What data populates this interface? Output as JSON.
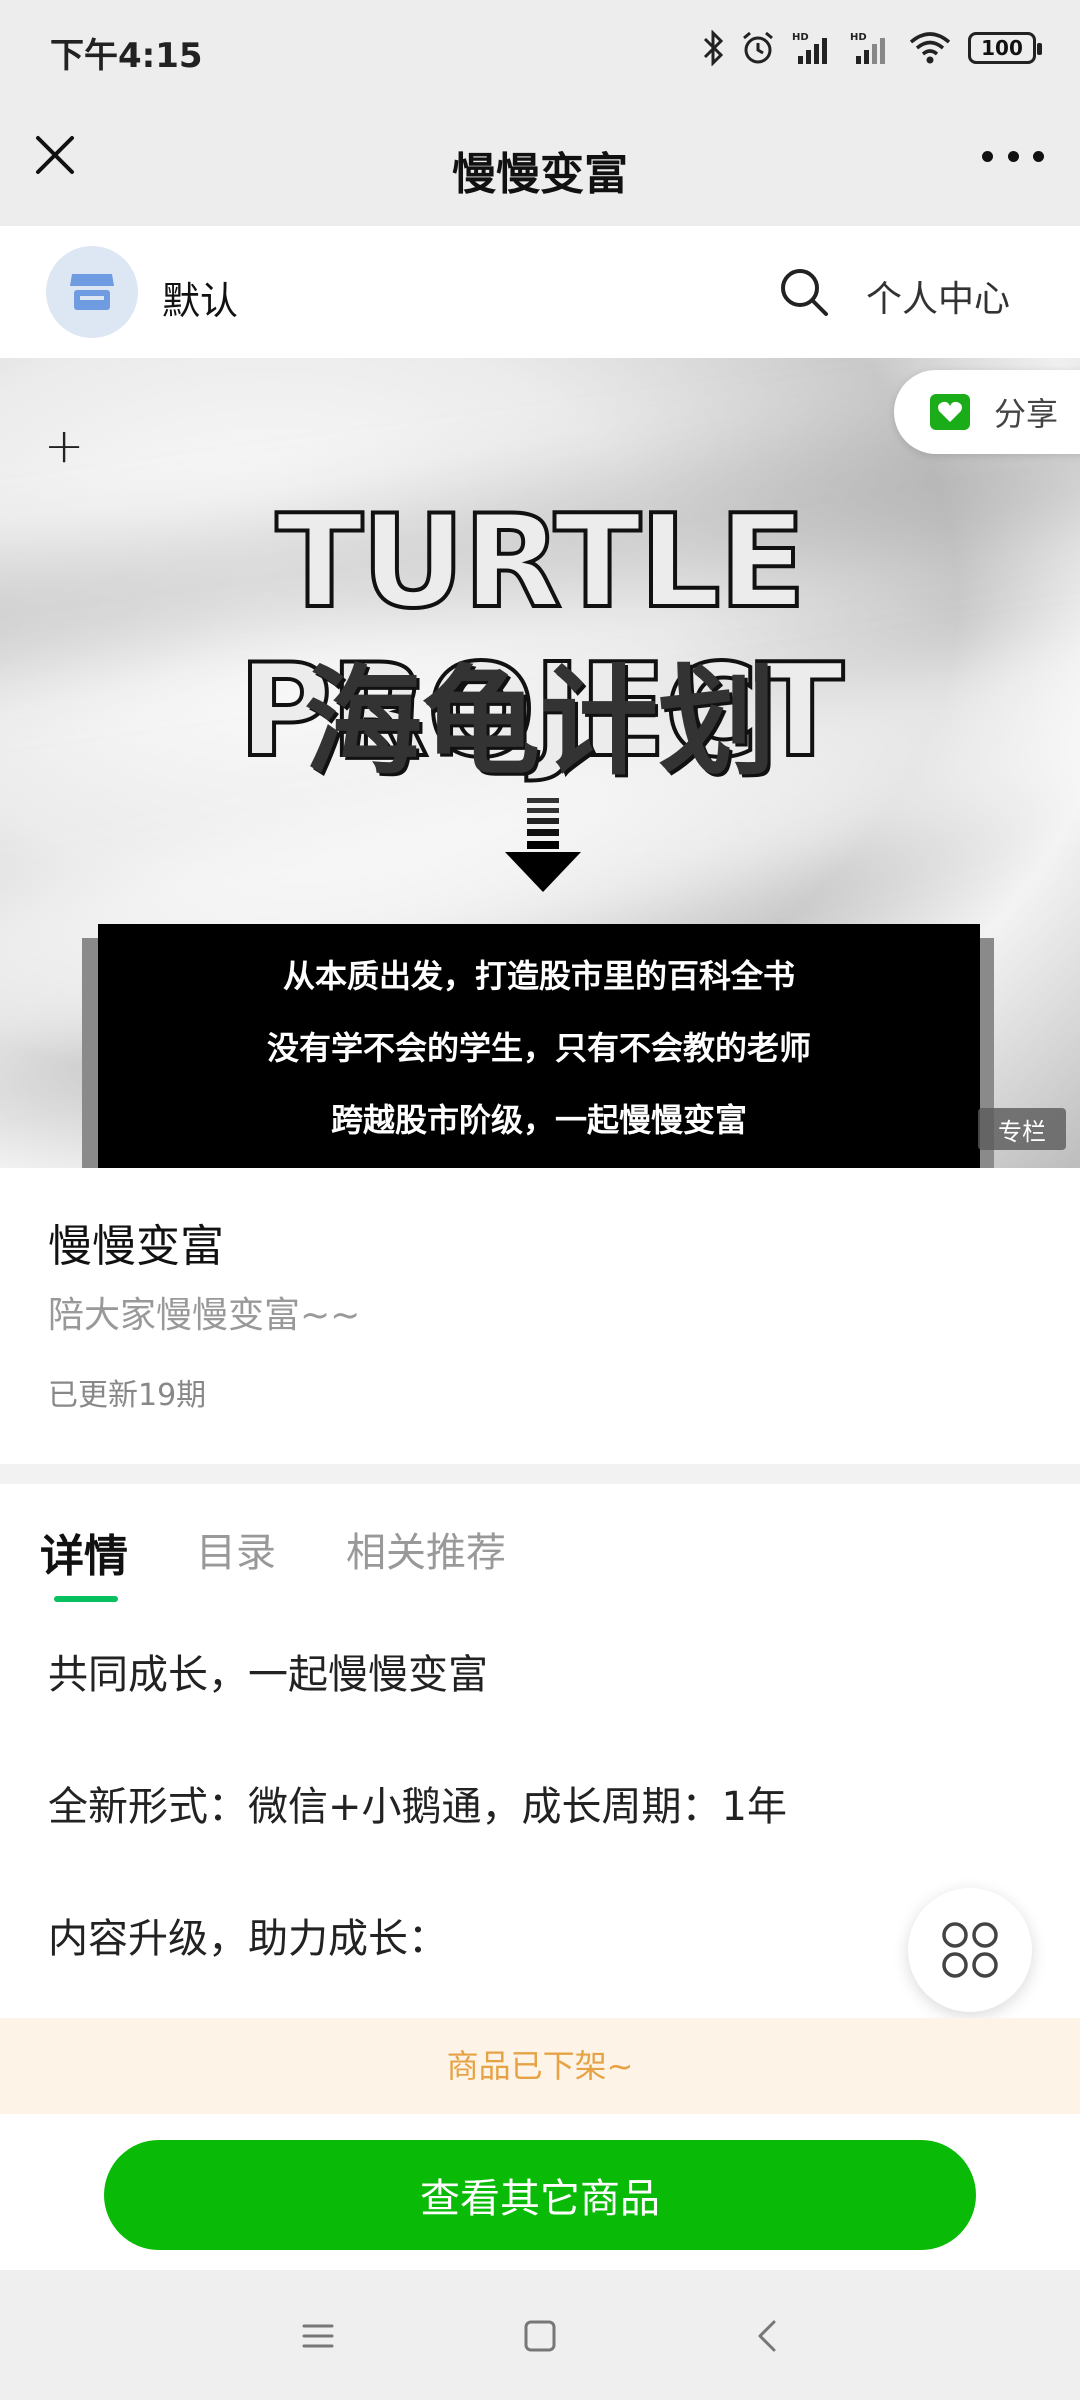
{
  "status_bar": {
    "time": "下午4:15",
    "battery": "100",
    "icons": [
      "bluetooth-icon",
      "alarm-icon",
      "signal-hd-icon",
      "signal-hd-icon",
      "wifi-icon",
      "battery-icon"
    ]
  },
  "title_bar": {
    "title": "慢慢变富"
  },
  "shop": {
    "name": "默认",
    "personal_center": "个人中心"
  },
  "banner": {
    "share_label": "分享",
    "heading_en": "TURTLE PROJECT",
    "heading_cn": "海龟计划",
    "lines": [
      "从本质出发，打造股市里的百科全书",
      "没有学不会的学生，只有不会教的老师",
      "跨越股市阶级，一起慢慢变富"
    ],
    "tag": "专栏"
  },
  "product": {
    "name": "慢慢变富",
    "description": "陪大家慢慢变富~~",
    "updates": "已更新19期"
  },
  "tabs": [
    {
      "label": "详情",
      "active": true
    },
    {
      "label": "目录",
      "active": false
    },
    {
      "label": "相关推荐",
      "active": false
    }
  ],
  "detail": {
    "lines": [
      "共同成长，一起慢慢变富",
      "全新形式：微信+小鹅通，成长周期：1年",
      "内容升级，助力成长："
    ]
  },
  "notice": "商品已下架~",
  "actions": {
    "view_other": "查看其它商品"
  },
  "colors": {
    "accent_green": "#07c160",
    "button_green": "#09bb07",
    "notice_text": "#e6a346",
    "notice_bg": "#fdf3e6"
  }
}
